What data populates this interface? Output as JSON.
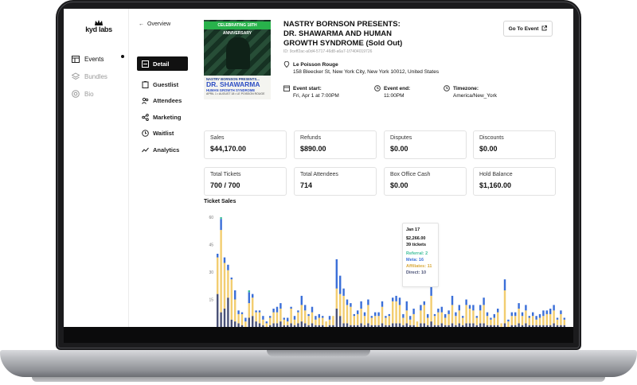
{
  "brand": {
    "logo_text": "kyd labs"
  },
  "rail": {
    "items": [
      {
        "label": "Events",
        "icon": "calendar-icon",
        "active": true
      },
      {
        "label": "Bundles",
        "icon": "layers-icon",
        "active": false
      },
      {
        "label": "Bio",
        "icon": "at-icon",
        "active": false
      }
    ]
  },
  "subnav": {
    "back_label": "Overview",
    "items": [
      {
        "label": "Detail",
        "icon": "detail-icon",
        "active": true
      },
      {
        "label": "Guestlist",
        "icon": "clipboard-icon"
      },
      {
        "label": "Attendees",
        "icon": "users-icon"
      },
      {
        "label": "Marketing",
        "icon": "share-icon"
      },
      {
        "label": "Waitlist",
        "icon": "clock-icon"
      },
      {
        "label": "Analytics",
        "icon": "trend-icon"
      }
    ]
  },
  "event": {
    "poster": {
      "banner": "CELEBRATING 18TH ANNIVERSARY",
      "line1": "NASTRY BORNSON PRESENTS...",
      "line2": "DR. SHAWARMA",
      "line3": "HUMAN GROWTH SYNDROME",
      "line4": "APRIL 1 • AUGUST 18 • LE POISSON ROUGE"
    },
    "title_line1": "NASTRY BORNSON PRESENTS:",
    "title_line2": "DR. SHAWARMA AND HUMAN",
    "title_line3": "GROWTH SYNDROME (Sold Out)",
    "id": "ID: 9ceff2ac-a0d4-5717-46d8-a6a7-1f7404019726",
    "go_to_event_label": "Go To Event",
    "venue_name": "Le Poisson Rouge",
    "venue_address": "158 Bleecker St, New York City, New York 10012, United States",
    "start_label": "Event start:",
    "start_value": "Fri, Apr 1 at 7:00PM",
    "end_label": "Event end:",
    "end_value": "11:00PM",
    "tz_label": "Timezone:",
    "tz_value": "America/New_York"
  },
  "stats": [
    {
      "label": "Sales",
      "value": "$44,170.00"
    },
    {
      "label": "Refunds",
      "value": "$890.00"
    },
    {
      "label": "Disputes",
      "value": "$0.00"
    },
    {
      "label": "Discounts",
      "value": "$0.00"
    },
    {
      "label": "Total Tickets",
      "value": "700 / 700"
    },
    {
      "label": "Total Attendees",
      "value": "714"
    },
    {
      "label": "Box Office Cash",
      "value": "$0.00"
    },
    {
      "label": "Hold Balance",
      "value": "$1,160.00"
    }
  ],
  "chart_title": "Ticket Sales",
  "chart_data": {
    "type": "bar",
    "ylim": [
      0,
      60
    ],
    "yticks": [
      "60",
      "45",
      "30",
      "15"
    ],
    "colors": {
      "referral": "#3fbf9a",
      "meta": "#3b6fd8",
      "affiliates": "#f2cd70",
      "direct": "#4a5176"
    },
    "series": [
      {
        "values": [
          0,
          1,
          0,
          0,
          0,
          0,
          0,
          0,
          0,
          1,
          0,
          0,
          0,
          0,
          0,
          0,
          0,
          0,
          0,
          0,
          0,
          0,
          0,
          0,
          0,
          0,
          0,
          0,
          0,
          0,
          0,
          0,
          0,
          0,
          0,
          0,
          0,
          0,
          0,
          0,
          0,
          0,
          0,
          0,
          0,
          0,
          0,
          0,
          0,
          0,
          0,
          0,
          0,
          0,
          0,
          0,
          0,
          0,
          0,
          0,
          0,
          0,
          0,
          0,
          0,
          0,
          0,
          0,
          0,
          0,
          0,
          0,
          0,
          0,
          0,
          0,
          0,
          0,
          0,
          0,
          0,
          0,
          0,
          0,
          0,
          0,
          0,
          0,
          0,
          0,
          0,
          0,
          0,
          0,
          0,
          0,
          0,
          0,
          0,
          0
        ]
      },
      {
        "values": [
          2,
          6,
          3,
          3,
          1,
          5,
          2,
          1,
          2,
          6,
          2,
          1,
          1,
          2,
          1,
          1,
          2,
          3,
          3,
          1,
          2,
          1,
          2,
          1,
          5,
          3,
          1,
          3,
          2,
          2,
          1,
          0,
          2,
          0,
          16,
          10,
          4,
          3,
          2,
          1,
          2,
          4,
          2,
          3,
          1,
          2,
          2,
          3,
          1,
          1,
          2,
          3,
          4,
          2,
          5,
          2,
          3,
          0,
          3,
          2,
          2,
          6,
          1,
          2,
          3,
          2,
          2,
          5,
          2,
          3,
          1,
          3,
          2,
          3,
          1,
          3,
          4,
          2,
          1,
          2,
          2,
          0,
          6,
          1,
          2,
          2,
          3,
          2,
          3,
          1,
          2,
          2,
          2,
          3,
          2,
          3,
          3,
          1,
          2,
          1
        ]
      },
      {
        "values": [
          20,
          45,
          25,
          15,
          22,
          12,
          5,
          6,
          3,
          8,
          10,
          5,
          6,
          3,
          2,
          4,
          6,
          6,
          7,
          3,
          2,
          8,
          3,
          6,
          9,
          7,
          5,
          6,
          3,
          4,
          4,
          3,
          3,
          5,
          11,
          12,
          15,
          10,
          10,
          5,
          6,
          8,
          5,
          10,
          4,
          5,
          5,
          9,
          4,
          5,
          12,
          12,
          10,
          4,
          7,
          3,
          6,
          3,
          7,
          10,
          4,
          14,
          5,
          7,
          6,
          4,
          6,
          10,
          5,
          7,
          4,
          10,
          8,
          7,
          4,
          7,
          10,
          5,
          3,
          4,
          7,
          2,
          18,
          3,
          5,
          5,
          8,
          5,
          7,
          4,
          5,
          3,
          4,
          5,
          6,
          6,
          7,
          3,
          6,
          3
        ]
      },
      {
        "values": [
          18,
          8,
          10,
          16,
          4,
          3,
          2,
          1,
          0,
          5,
          6,
          3,
          2,
          1,
          0,
          1,
          2,
          2,
          3,
          1,
          1,
          2,
          1,
          2,
          3,
          2,
          1,
          2,
          1,
          1,
          1,
          0,
          1,
          1,
          10,
          6,
          2,
          2,
          1,
          1,
          1,
          2,
          1,
          2,
          1,
          1,
          1,
          2,
          1,
          1,
          2,
          2,
          2,
          1,
          2,
          1,
          1,
          0,
          2,
          2,
          1,
          3,
          1,
          1,
          2,
          1,
          1,
          2,
          1,
          2,
          1,
          2,
          2,
          2,
          1,
          2,
          2,
          1,
          1,
          1,
          1,
          0,
          2,
          0,
          1,
          1,
          2,
          1,
          2,
          1,
          1,
          1,
          1,
          1,
          1,
          1,
          2,
          1,
          1,
          1
        ]
      }
    ],
    "tooltip": {
      "date": "Jan 17",
      "amount": "$2,266.00",
      "tickets": "39 tickets",
      "referral": "Referral: 2",
      "meta": "Meta: 16",
      "affiliates": "Affiliates: 11",
      "direct": "Direct: 10"
    }
  }
}
